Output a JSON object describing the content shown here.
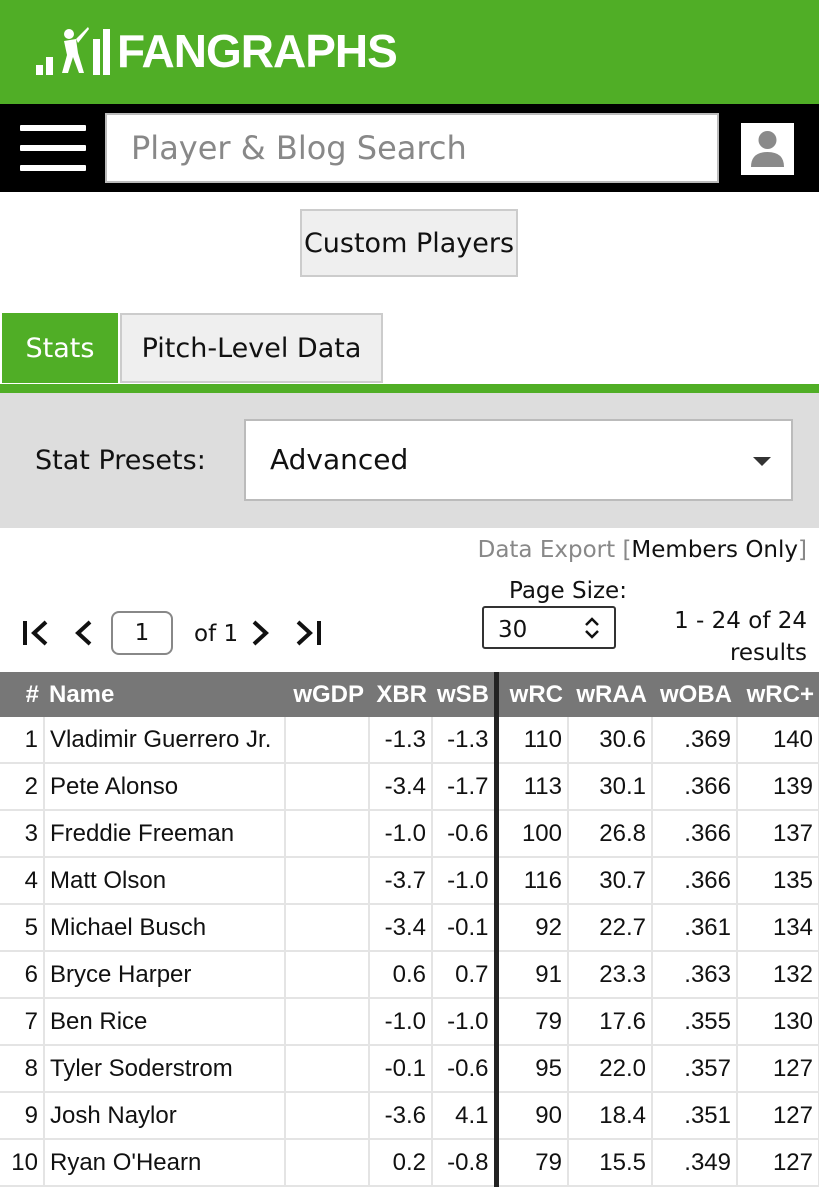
{
  "header": {
    "logo_text": "FANGRAPHS",
    "brand_color": "#50ae26"
  },
  "nav": {
    "menu_icon": "hamburger-icon",
    "search_placeholder": "Player & Blog Search",
    "user_icon": "user-icon"
  },
  "custom_players_label": "Custom Players",
  "tabs": [
    {
      "label": "Stats",
      "active": true
    },
    {
      "label": "Pitch-Level Data",
      "active": false
    }
  ],
  "presets": {
    "label": "Stat Presets:",
    "selected": "Advanced"
  },
  "export": {
    "prefix": "Data Export [",
    "members": "Members Only",
    "suffix": "]"
  },
  "pager": {
    "current_page": "1",
    "of_label": "of 1"
  },
  "page_size": {
    "label": "Page Size:",
    "selected": "30"
  },
  "results": {
    "range": "1 - 24 of 24",
    "label": "results"
  },
  "table": {
    "columns": [
      "#",
      "Name",
      "wGDP",
      "XBR",
      "wSB",
      "wRC",
      "wRAA",
      "wOBA",
      "wRC+"
    ],
    "rows": [
      [
        "1",
        "Vladimir Guerrero Jr.",
        "",
        "-1.3",
        "-1.3",
        "110",
        "30.6",
        ".369",
        "140"
      ],
      [
        "2",
        "Pete Alonso",
        "",
        "-3.4",
        "-1.7",
        "113",
        "30.1",
        ".366",
        "139"
      ],
      [
        "3",
        "Freddie Freeman",
        "",
        "-1.0",
        "-0.6",
        "100",
        "26.8",
        ".366",
        "137"
      ],
      [
        "4",
        "Matt Olson",
        "",
        "-3.7",
        "-1.0",
        "116",
        "30.7",
        ".366",
        "135"
      ],
      [
        "5",
        "Michael Busch",
        "",
        "-3.4",
        "-0.1",
        "92",
        "22.7",
        ".361",
        "134"
      ],
      [
        "6",
        "Bryce Harper",
        "",
        "0.6",
        "0.7",
        "91",
        "23.3",
        ".363",
        "132"
      ],
      [
        "7",
        "Ben Rice",
        "",
        "-1.0",
        "-1.0",
        "79",
        "17.6",
        ".355",
        "130"
      ],
      [
        "8",
        "Tyler Soderstrom",
        "",
        "-0.1",
        "-0.6",
        "95",
        "22.0",
        ".357",
        "127"
      ],
      [
        "9",
        "Josh Naylor",
        "",
        "-3.6",
        "4.1",
        "90",
        "18.4",
        ".351",
        "127"
      ],
      [
        "10",
        "Ryan O'Hearn",
        "",
        "0.2",
        "-0.8",
        "79",
        "15.5",
        ".349",
        "127"
      ]
    ]
  }
}
